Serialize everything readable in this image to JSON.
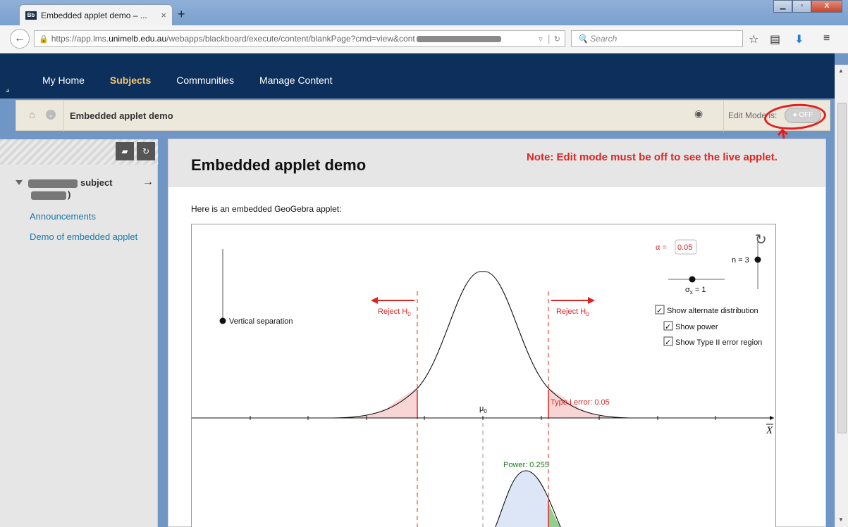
{
  "browser": {
    "tab_favicon": "Bb",
    "tab_title": "Embedded applet demo – ...",
    "tab_close": "×",
    "new_tab": "+",
    "url_prefix": "https://app.lms.",
    "url_host": "unimelb.edu.au",
    "url_path": "/webapps/blackboard/execute/content/blankPage?cmd=view&cont",
    "search_placeholder": "Search"
  },
  "blackboard": {
    "nav": [
      "My Home",
      "Subjects",
      "Communities",
      "Manage Content"
    ],
    "active_nav": "Subjects",
    "breadcrumb_title": "Embedded applet demo",
    "edit_mode_label": "Edit Mode is:",
    "edit_mode_value": "OFF"
  },
  "sidebar": {
    "subject_label": "subject",
    "subject_close": ")",
    "links": [
      "Announcements",
      "Demo of embedded applet"
    ]
  },
  "content": {
    "title": "Embedded applet demo",
    "note": "Note: Edit mode must be off to see the live applet.",
    "intro": "Here is an embedded GeoGebra applet:"
  },
  "applet": {
    "vertical_separation": "Vertical separation",
    "reject_left": "Reject H",
    "reject_right": "Reject H",
    "h_sub": "0",
    "alpha_label": "α =",
    "alpha_value": "0.05",
    "n_label": "n = 3",
    "sigma_label": "σ",
    "sigma_sub": "x",
    "sigma_value": " = 1",
    "show_alternate": "Show alternate distribution",
    "show_power": "Show power",
    "show_type2": "Show Type II error region",
    "type1_error": "Type I error: 0.05",
    "mu0": "μ",
    "mu0_sub": "0",
    "xbar": "X",
    "power": "Power: 0.255"
  },
  "colors": {
    "accent_red": "#e02424",
    "bb_navy": "#0d2f5c",
    "active_gold": "#f4c96b",
    "link_blue": "#1a7aa8",
    "power_green": "#1b7a1b"
  }
}
